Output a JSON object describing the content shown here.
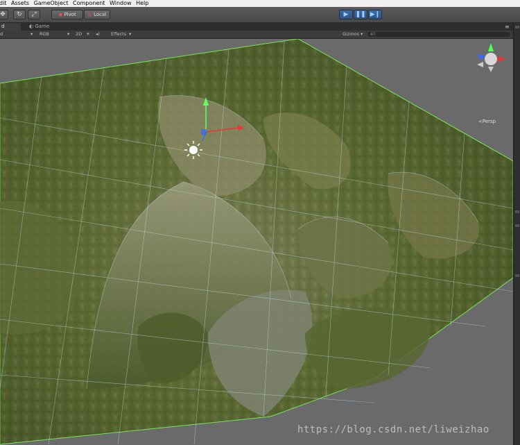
{
  "menu": {
    "items": [
      "dit",
      "Assets",
      "GameObject",
      "Component",
      "Window",
      "Help"
    ]
  },
  "toolbar": {
    "pivot_label": "Pivot",
    "local_label": "Local",
    "icons": [
      "move-icon",
      "rotate-icon",
      "scale-icon"
    ],
    "play_icons": [
      "play-icon",
      "pause-icon",
      "step-icon"
    ]
  },
  "tabs": {
    "scene_tab_label": "d",
    "game_tab_label": "Game"
  },
  "scene_toolbar": {
    "shading_mode": "d",
    "render_mode": "RGB",
    "mode_2d": "2D",
    "effects_label": "Effects",
    "gizmos_label": "Gizmos",
    "search_placeholder": "All"
  },
  "viewport": {
    "projection_label": "Persp",
    "axis_labels": {
      "y": "y",
      "x": "x",
      "z": "z"
    },
    "watermark": "https://blog.csdn.net/liweizhao"
  },
  "colors": {
    "play_active": "#2b5386",
    "terrain_dark": "#4a5a2a",
    "terrain_light": "#8a8a5a",
    "wire": "#c8e6ff",
    "selection_green": "#7cff5a"
  }
}
